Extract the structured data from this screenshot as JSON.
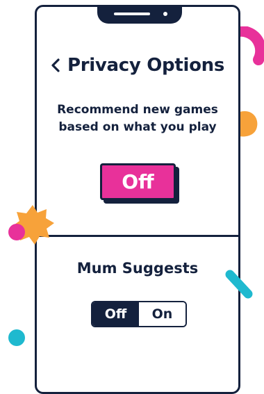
{
  "colors": {
    "navy": "#14213d",
    "pink": "#e8319a",
    "orange": "#f7a23a",
    "teal": "#1fb9cf",
    "white": "#ffffff"
  },
  "header": {
    "back_icon": "chevron-left-icon",
    "title": "Privacy Options"
  },
  "recommendations": {
    "description_line1": "Recommend new games",
    "description_line2": "based on what you play",
    "button_label": "Off"
  },
  "mum_suggests": {
    "title": "Mum Suggests",
    "toggle": {
      "options": [
        "Off",
        "On"
      ],
      "selected": "Off"
    }
  }
}
